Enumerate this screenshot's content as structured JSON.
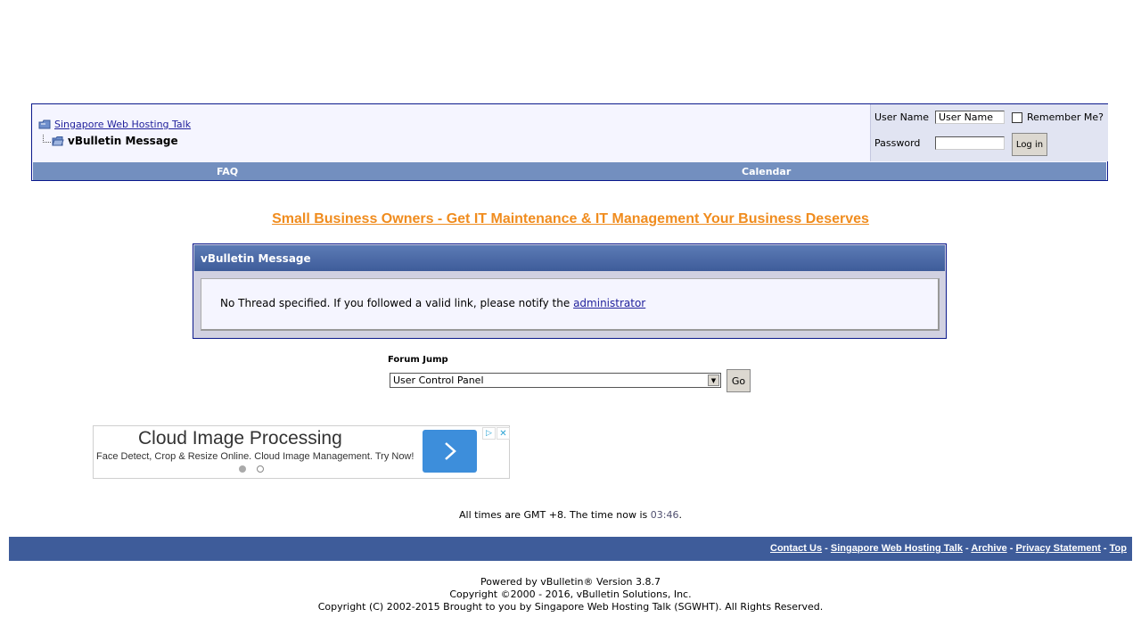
{
  "navbar": {
    "breadcrumb_root": "Singapore Web Hosting Talk",
    "current_page": "vBulletin Message"
  },
  "login": {
    "username_label": "User Name",
    "username_value": "User Name",
    "password_label": "Password",
    "password_value": "",
    "remember_label": "Remember Me?",
    "remember_checked": false,
    "login_button": "Log in"
  },
  "nav_links": [
    "FAQ",
    "Calendar"
  ],
  "promo": {
    "text": "Small Business Owners - Get IT Maintenance & IT Management Your Business Deserves"
  },
  "message": {
    "title": "vBulletin Message",
    "text": "No Thread specified. If you followed a valid link, please notify the",
    "link": "administrator"
  },
  "forum_jump": {
    "label": "Forum Jump",
    "selected": "User Control Panel",
    "go_button": "Go"
  },
  "ad": {
    "title": "Cloud Image Processing",
    "description": "Face Detect, Crop & Resize Online. Cloud Image Management. Try Now!",
    "arrow_icon": "chevron-right-icon",
    "choices_icon": "adchoices-icon",
    "close_icon": "close-icon"
  },
  "time": {
    "prefix": "All times are GMT +8. The time now is",
    "now": "03:46",
    "suffix": "."
  },
  "footer": {
    "links": [
      "Contact Us",
      "Singapore Web Hosting Talk",
      "Archive",
      "Privacy Statement",
      "Top"
    ],
    "separator": " - "
  },
  "powered": {
    "line1": "Powered by vBulletin® Version 3.8.7",
    "line2": "Copyright ©2000 - 2016, vBulletin Solutions, Inc.",
    "line3": "Copyright (C) 2002-2015 Brought to you by Singapore Web Hosting Talk (SGWHT). All Rights Reserved."
  },
  "colors": {
    "nav_strip": "#738fbf",
    "header_gradient_top": "#5c7bb5",
    "footer_bar": "#3e5c9a",
    "promo": "#f08c1e",
    "ad_button": "#3d8edb"
  }
}
